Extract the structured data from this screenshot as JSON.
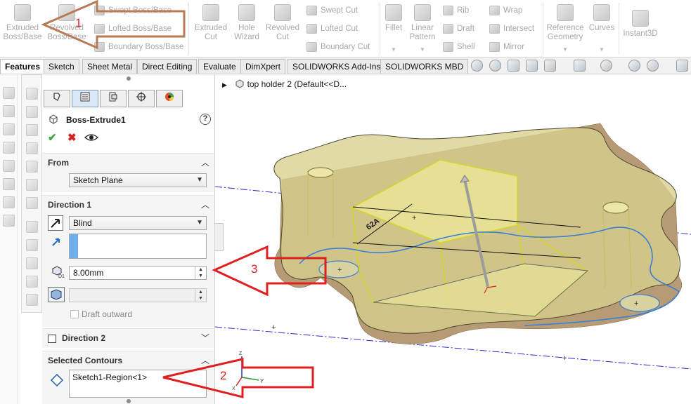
{
  "ribbon": {
    "group1": {
      "extruded_boss": "Extruded Boss/Base",
      "revolved_boss": "Revolved Boss/Base",
      "swept_boss": "Swept Boss/Base",
      "lofted_boss": "Lofted Boss/Base",
      "boundary_boss": "Boundary Boss/Base"
    },
    "group2": {
      "extruded_cut": "Extruded Cut",
      "hole_wizard": "Hole Wizard",
      "revolved_cut": "Revolved Cut",
      "swept_cut": "Swept Cut",
      "lofted_cut": "Lofted Cut",
      "boundary_cut": "Boundary Cut"
    },
    "group3": {
      "fillet": "Fillet",
      "linear_pattern": "Linear Pattern",
      "rib": "Rib",
      "draft": "Draft",
      "shell": "Shell",
      "wrap": "Wrap",
      "intersect": "Intersect",
      "mirror": "Mirror"
    },
    "group4": {
      "reference_geometry": "Reference Geometry",
      "curves": "Curves"
    },
    "group5": {
      "instant3d": "Instant3D"
    }
  },
  "tabs": [
    "Features",
    "Sketch",
    "Sheet Metal",
    "Direct Editing",
    "Evaluate",
    "DimXpert",
    "SOLIDWORKS Add-Ins",
    "SOLIDWORKS MBD"
  ],
  "property_manager": {
    "title": "Boss-Extrude1",
    "help": "?",
    "from": {
      "title": "From",
      "value": "Sketch Plane"
    },
    "direction1": {
      "title": "Direction 1",
      "end_condition": "Blind",
      "depth": "8.00mm",
      "draft_outward": "Draft outward"
    },
    "direction2": {
      "title": "Direction 2"
    },
    "selected_contours": {
      "title": "Selected Contours",
      "value": "Sketch1-Region<1>"
    }
  },
  "graphics": {
    "tree_item": "top holder 2  (Default<<D...",
    "dimension_label": "62A",
    "triad": {
      "x": "X",
      "y": "Y",
      "z": "Z"
    }
  },
  "annotations": [
    {
      "number": "1",
      "color": "#b97a57"
    },
    {
      "number": "2",
      "color": "#e02020"
    },
    {
      "number": "3",
      "color": "#e02020"
    }
  ],
  "colors": {
    "part_body": "#d8cf8e",
    "part_shadow": "#b59672",
    "selection_yellow": "#e6e64a",
    "contour_blue": "#3a7fd5",
    "axis_blue": "#2a2ad0"
  }
}
